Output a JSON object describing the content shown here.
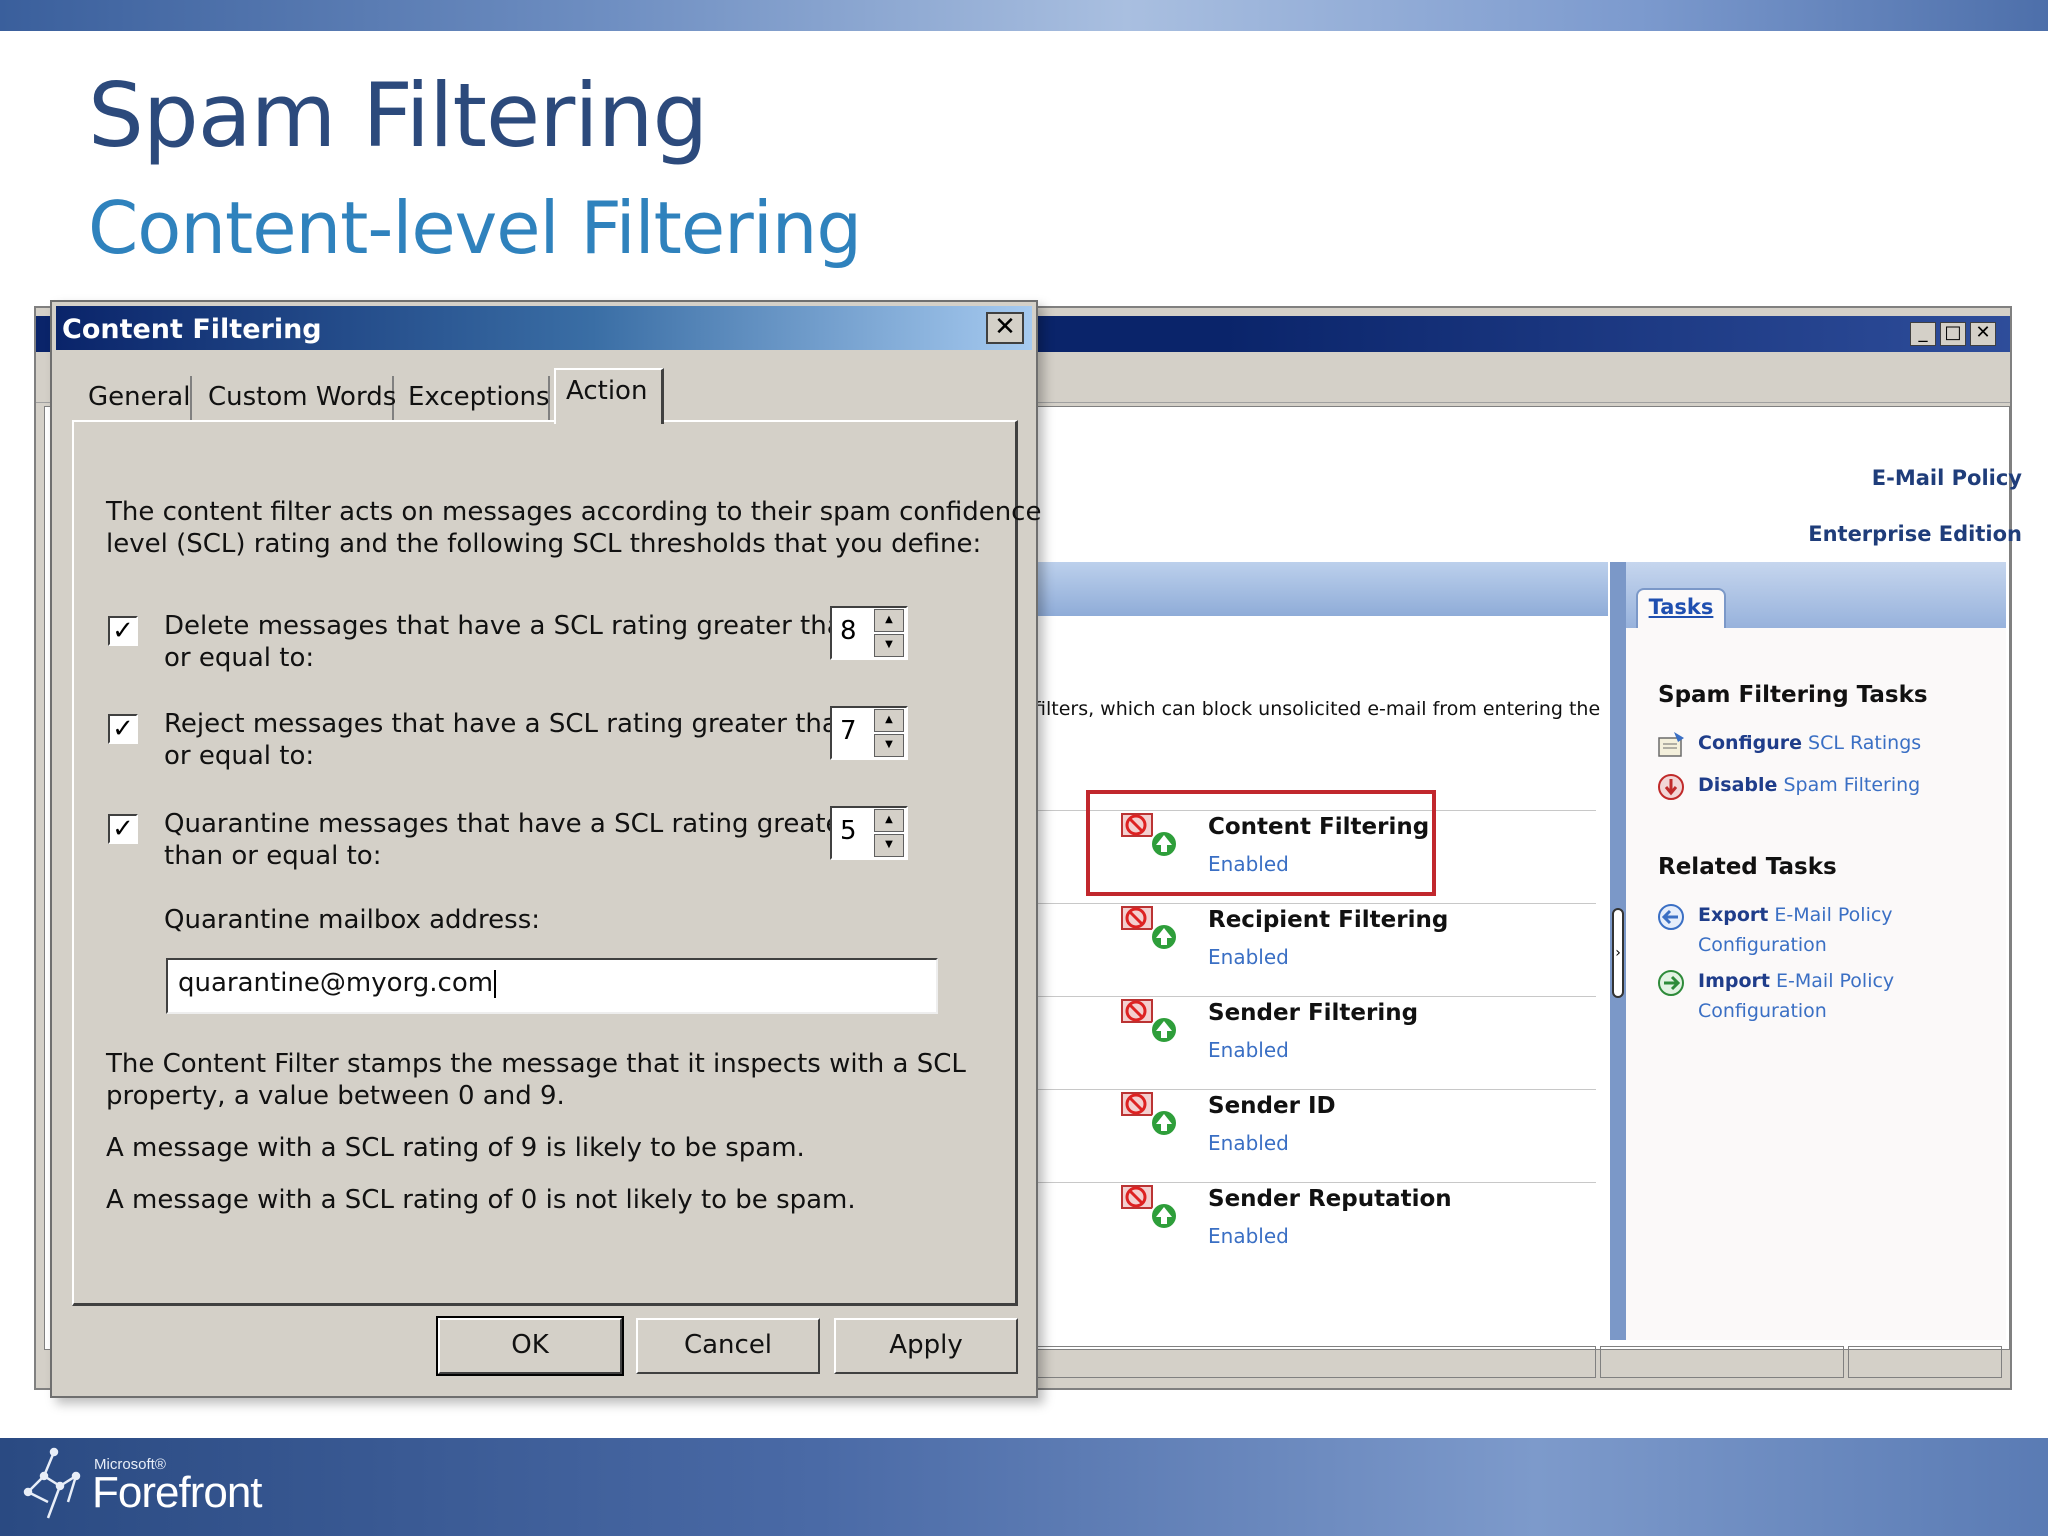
{
  "slide": {
    "title": "Spam Filtering",
    "subtitle": "Content-level Filtering",
    "footer_brand_small": "Microsoft®",
    "footer_brand": "Forefront"
  },
  "console": {
    "brand_line1": "E-Mail Policy",
    "brand_line2": "Enterprise Edition",
    "intro_text": "filters, which can block unsolicited e-mail from entering the",
    "window_buttons": [
      "_",
      "□",
      "✕"
    ],
    "filters": [
      {
        "name": "Content Filtering",
        "status": "Enabled",
        "highlighted": true
      },
      {
        "name": "Recipient Filtering",
        "status": "Enabled"
      },
      {
        "name": "Sender Filtering",
        "status": "Enabled"
      },
      {
        "name": "Sender ID",
        "status": "Enabled"
      },
      {
        "name": "Sender Reputation",
        "status": "Enabled"
      }
    ],
    "tasks_tab": "Tasks",
    "spam_tasks_heading": "Spam Filtering Tasks",
    "spam_tasks": [
      {
        "verb": "Configure",
        "rest": "SCL Ratings",
        "icon": "configure-icon"
      },
      {
        "verb": "Disable",
        "rest": "Spam Filtering",
        "icon": "disable-icon"
      }
    ],
    "related_heading": "Related Tasks",
    "related_tasks": [
      {
        "verb": "Export",
        "rest": "E-Mail Policy",
        "line2": "Configuration",
        "icon": "export-icon"
      },
      {
        "verb": "Import",
        "rest": "E-Mail Policy",
        "line2": "Configuration",
        "icon": "import-icon"
      }
    ],
    "highlight_color": "#c1272d"
  },
  "dialog": {
    "title": "Content Filtering",
    "close_glyph": "✕",
    "tabs": [
      "General",
      "Custom Words",
      "Exceptions",
      "Action"
    ],
    "active_tab": "Action",
    "intro_line1": "The content filter acts on messages according to their spam confidence",
    "intro_line2": "level (SCL) rating and the following SCL thresholds that you define:",
    "thresholds": [
      {
        "label1": "Delete messages that have a SCL rating greater than",
        "label2": "or equal to:",
        "checked": true,
        "value": "8"
      },
      {
        "label1": "Reject messages that have a SCL rating greater than",
        "label2": "or equal to:",
        "checked": true,
        "value": "7"
      },
      {
        "label1": "Quarantine messages that have a SCL rating greater",
        "label2": "than or equal to:",
        "checked": true,
        "value": "5"
      }
    ],
    "check_glyph": "✓",
    "quarantine_label": "Quarantine mailbox address:",
    "quarantine_value": "quarantine@myorg.com",
    "note1_line1": "The Content Filter stamps the message that it inspects with a SCL",
    "note1_line2": "property, a value between 0 and 9.",
    "note2": "A message with a SCL rating of 9 is likely to be spam.",
    "note3": "A message with a SCL rating of 0 is not likely to be spam.",
    "buttons": {
      "ok": "OK",
      "cancel": "Cancel",
      "apply": "Apply"
    }
  }
}
